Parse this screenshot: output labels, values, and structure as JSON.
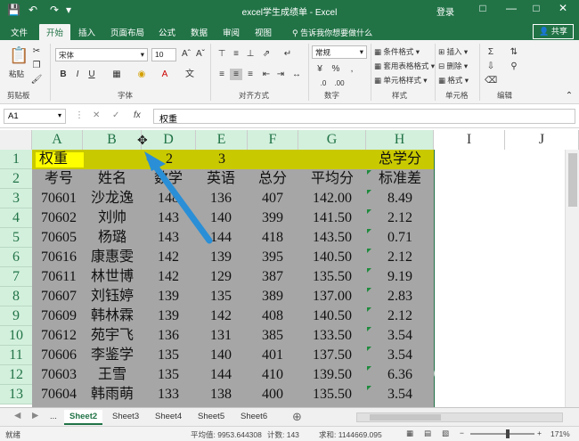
{
  "window": {
    "title": "excel学生成绩单 - Excel",
    "login": "登录"
  },
  "tabs": [
    "文件",
    "开始",
    "插入",
    "页面布局",
    "公式",
    "数据",
    "审阅",
    "视图"
  ],
  "tell_me": "告诉我你想要做什么",
  "share": "共享",
  "ribbon": {
    "clipboard": {
      "paste": "粘贴",
      "label": "剪贴板"
    },
    "font": {
      "name": "宋体",
      "size": "10",
      "label": "字体"
    },
    "alignment": {
      "label": "对齐方式"
    },
    "number": {
      "format": "常规",
      "label": "数字"
    },
    "styles": {
      "cond": "条件格式",
      "table": "套用表格格式",
      "cell": "单元格样式",
      "label": "样式"
    },
    "cells": {
      "insert": "插入",
      "delete": "删除",
      "format": "格式",
      "label": "单元格"
    },
    "editing": {
      "label": "编辑"
    }
  },
  "formula_bar": {
    "name_box": "A1",
    "content": "权重"
  },
  "columns": [
    "A",
    "B",
    "D",
    "E",
    "F",
    "G",
    "H",
    "I",
    "J"
  ],
  "rows": [
    "1",
    "2",
    "3",
    "4",
    "5",
    "6",
    "7",
    "8",
    "9",
    "10",
    "11",
    "12",
    "13"
  ],
  "row1": {
    "a": "权重",
    "d": "2",
    "e": "3",
    "h": "总学分"
  },
  "headers": [
    "考号",
    "姓名",
    "数学",
    "英语",
    "总分",
    "平均分",
    "标准差"
  ],
  "data_rows": [
    [
      "70601",
      "沙龙逸",
      "148",
      "136",
      "407",
      "142.00",
      "8.49"
    ],
    [
      "70602",
      "刘帅",
      "143",
      "140",
      "399",
      "141.50",
      "2.12"
    ],
    [
      "70605",
      "杨璐",
      "143",
      "144",
      "418",
      "143.50",
      "0.71"
    ],
    [
      "70616",
      "康惠雯",
      "142",
      "139",
      "395",
      "140.50",
      "2.12"
    ],
    [
      "70611",
      "林世博",
      "142",
      "129",
      "387",
      "135.50",
      "9.19"
    ],
    [
      "70607",
      "刘钰婷",
      "139",
      "135",
      "389",
      "137.00",
      "2.83"
    ],
    [
      "70609",
      "韩林霖",
      "139",
      "142",
      "408",
      "140.50",
      "2.12"
    ],
    [
      "70612",
      "苑宇飞",
      "136",
      "131",
      "385",
      "133.50",
      "3.54"
    ],
    [
      "70606",
      "李鉴学",
      "135",
      "140",
      "401",
      "137.50",
      "3.54"
    ],
    [
      "70603",
      "王雪",
      "135",
      "144",
      "410",
      "139.50",
      "6.36"
    ],
    [
      "70604",
      "韩雨萌",
      "133",
      "138",
      "400",
      "135.50",
      "3.54"
    ]
  ],
  "sheets": [
    "...",
    "Sheet2",
    "Sheet3",
    "Sheet4",
    "Sheet5",
    "Sheet6"
  ],
  "status": {
    "ready": "就绪",
    "average": "平均值: 9953.644308",
    "count": "计数: 143",
    "sum": "求和: 1144669.095",
    "zoom": "171%"
  },
  "watermark": "搜狗指南"
}
